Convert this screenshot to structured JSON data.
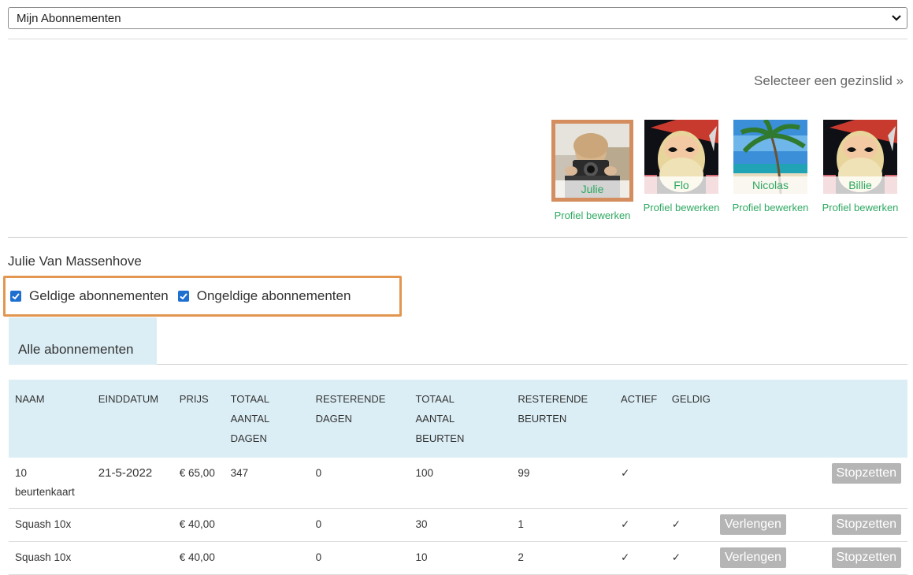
{
  "subscription_select": {
    "value": "Mijn Abonnementen"
  },
  "family": {
    "prompt": "Selecteer een gezinslid »",
    "members": [
      {
        "name": "Julie",
        "edit_label": "Profiel bewerken"
      },
      {
        "name": "Flo",
        "edit_label": "Profiel bewerken"
      },
      {
        "name": "Nicolas",
        "edit_label": "Profiel bewerken"
      },
      {
        "name": "Billie",
        "edit_label": "Profiel bewerken"
      }
    ]
  },
  "selected_user": "Julie Van Massenhove",
  "filters": {
    "valid_label": "Geldige abonnementen",
    "invalid_label": "Ongeldige abonnementen"
  },
  "tabs": {
    "all_label": "Alle abonnementen"
  },
  "table": {
    "headers": {
      "naam": "NAAM",
      "einddatum": "EINDDATUM",
      "prijs": "PRIJS",
      "totaal_dagen": "TOTAAL AANTAL DAGEN",
      "resterende_dagen": "RESTERENDE DAGEN",
      "totaal_beurten": "TOTAAL AANTAL BEURTEN",
      "resterende_beurten": "RESTERENDE BEURTEN",
      "actief": "ACTIEF",
      "geldig": "GELDIG"
    },
    "rows": [
      {
        "naam": "10 beurtenkaart",
        "einddatum": "21-5-2022",
        "prijs": "€ 65,00",
        "totaal_dagen": "347",
        "resterende_dagen": "0",
        "totaal_beurten": "100",
        "resterende_beurten": "99",
        "actief": "✓",
        "geldig": "",
        "verlengen": "",
        "stopzetten": "Stopzetten"
      },
      {
        "naam": "Squash 10x",
        "einddatum": "",
        "prijs": "€ 40,00",
        "totaal_dagen": "",
        "resterende_dagen": "0",
        "totaal_beurten": "30",
        "resterende_beurten": "1",
        "actief": "✓",
        "geldig": "✓",
        "verlengen": "Verlengen",
        "stopzetten": "Stopzetten"
      },
      {
        "naam": "Squash 10x",
        "einddatum": "",
        "prijs": "€ 40,00",
        "totaal_dagen": "",
        "resterende_dagen": "0",
        "totaal_beurten": "10",
        "resterende_beurten": "2",
        "actief": "✓",
        "geldig": "✓",
        "verlengen": "Verlengen",
        "stopzetten": "Stopzetten"
      }
    ]
  },
  "colors": {
    "accent_green": "#2da860",
    "highlight_orange": "#e2964f",
    "header_blue": "#dbeef5",
    "button_gray": "#b5b5b5",
    "checkbox_blue": "#1f6fd1"
  }
}
